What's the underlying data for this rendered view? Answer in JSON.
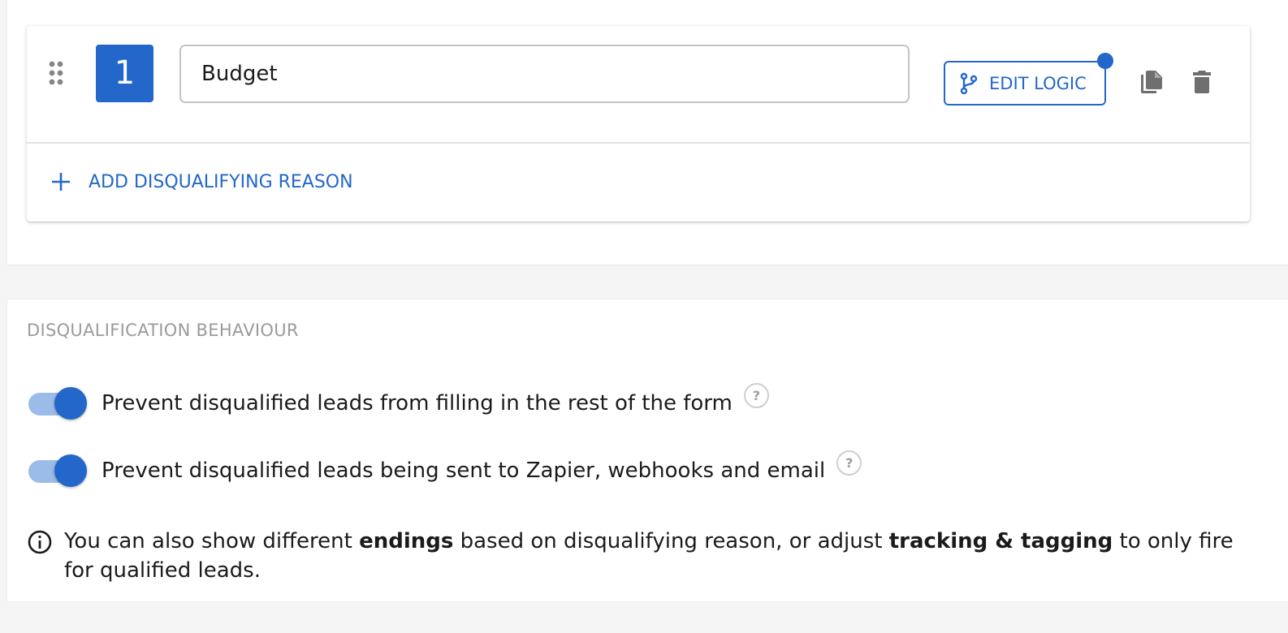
{
  "reason": {
    "number": "1",
    "input_value": "Budget",
    "edit_logic_label": "EDIT LOGIC",
    "has_logic_indicator": true,
    "add_reason_label": "ADD DISQUALIFYING REASON"
  },
  "behaviour": {
    "title": "DISQUALIFICATION BEHAVIOUR",
    "toggles": [
      {
        "label": "Prevent disqualified leads from filling in the rest of the form",
        "enabled": true,
        "help": "?"
      },
      {
        "label": "Prevent disqualified leads being sent to Zapier, webhooks and email",
        "enabled": true,
        "help": "?"
      }
    ],
    "info": {
      "part1": "You can also show different ",
      "bold1": "endings",
      "part2": " based on disqualifying reason, or adjust ",
      "bold2": "tracking & tagging",
      "part3": " to only fire for qualified leads."
    }
  },
  "icons": {
    "drag": "drag-handle-icon",
    "branch": "branch-icon",
    "copy": "copy-icon",
    "delete": "trash-icon",
    "plus": "plus-icon",
    "help": "help-circle-icon",
    "info": "info-circle-icon"
  },
  "colors": {
    "accent": "#2267c9",
    "toggle_track": "#9bbbe8",
    "muted_text": "#9b9b9b",
    "icon_gray": "#6f6f6f"
  }
}
